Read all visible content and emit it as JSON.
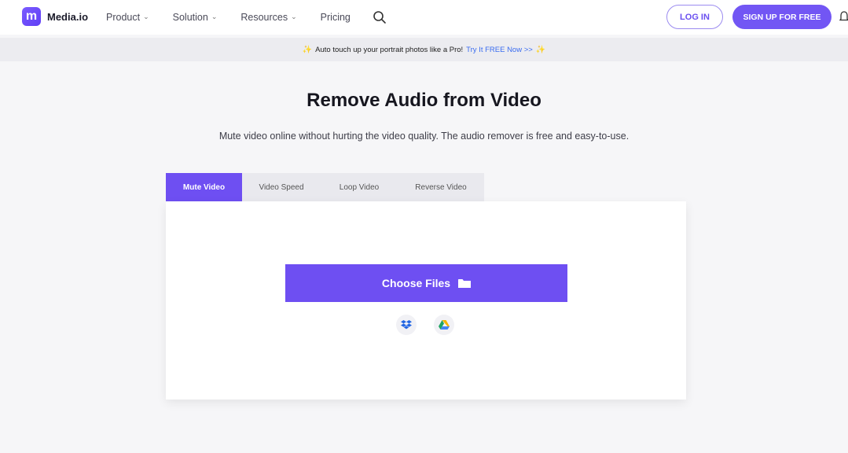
{
  "header": {
    "logo_letter": "m",
    "logo_text": "Media.io",
    "nav": [
      {
        "label": "Product",
        "has_chevron": true
      },
      {
        "label": "Solution",
        "has_chevron": true
      },
      {
        "label": "Resources",
        "has_chevron": true
      },
      {
        "label": "Pricing",
        "has_chevron": false
      }
    ],
    "login_label": "LOG IN",
    "signup_label": "SIGN UP FOR FREE"
  },
  "promo": {
    "text": "Auto touch up your portrait photos like a Pro!",
    "link_text": "Try It FREE Now >>"
  },
  "main": {
    "title": "Remove Audio from Video",
    "subtitle": "Mute video online without hurting the video quality. The audio remover is free and easy-to-use.",
    "tabs": [
      {
        "label": "Mute Video",
        "active": true
      },
      {
        "label": "Video Speed",
        "active": false
      },
      {
        "label": "Loop Video",
        "active": false
      },
      {
        "label": "Reverse Video",
        "active": false
      }
    ],
    "choose_files_label": "Choose Files",
    "cloud_sources": [
      "dropbox-icon",
      "google-drive-icon"
    ]
  },
  "colors": {
    "brand": "#6e4ff2",
    "link": "#3b6df0",
    "promo_bg": "#ececf0",
    "page_bg": "#f6f6f8"
  }
}
